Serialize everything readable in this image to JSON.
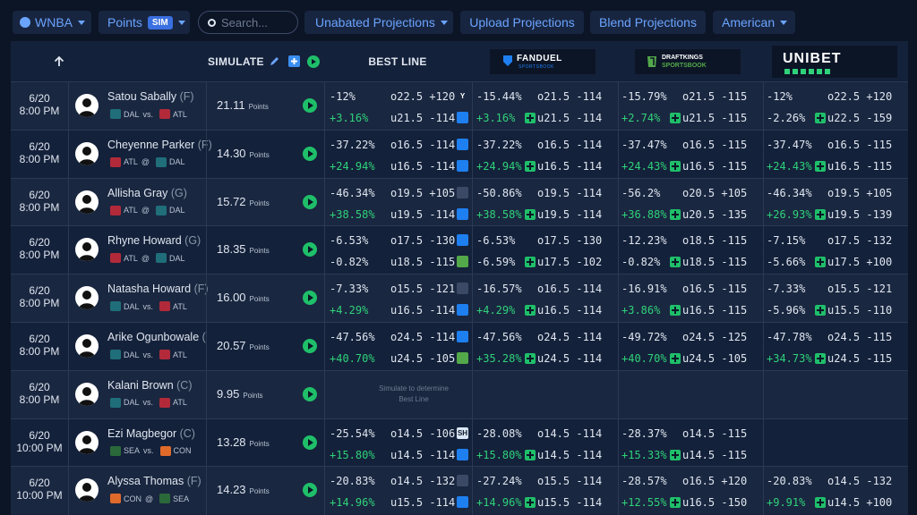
{
  "topbar": {
    "league": "WNBA",
    "stat": "Points",
    "sim_badge": "SIM",
    "search_placeholder": "Search...",
    "unabated": "Unabated Projections",
    "upload": "Upload Projections",
    "blend": "Blend Projections",
    "odds_format": "American"
  },
  "header": {
    "simulate": "SIMULATE",
    "best_line": "BEST LINE",
    "fanduel": "FANDUEL",
    "fanduel_sub": "SPORTSBOOK",
    "draftkings": "DRAFTKINGS",
    "draftkings_sub": "SPORTSBOOK",
    "unibet": "UNIBET"
  },
  "colors": {
    "accent": "#6aa4ff",
    "green": "#2fd27a",
    "bg": "#0c1526",
    "table": "#14213a"
  },
  "simulate_note": [
    "Simulate to determine",
    "Best Line"
  ],
  "rows": [
    {
      "date": "6/20",
      "time": "8:00 PM",
      "name": "Satou Sabally",
      "pos": "(F)",
      "t1": "DAL",
      "sep": "vs.",
      "t2": "ATL",
      "proj": "21.11",
      "unit": "Points",
      "best": {
        "oe": "-12%",
        "ol": "o22.5 +120",
        "ue": "+3.16%",
        "ul": "u21.5 -114",
        "oicon": "Y",
        "uicon": "fd"
      },
      "books": [
        {
          "oe": "-15.44%",
          "ol": "o21.5 -114",
          "ue": "+3.16%",
          "ul": "u21.5 -114"
        },
        {
          "oe": "-15.79%",
          "ol": "o21.5 -115",
          "ue": "+2.74%",
          "ul": "u21.5 -115"
        },
        {
          "oe": "-12%",
          "ol": "o22.5 +120",
          "ue": "-2.26%",
          "ul": "u22.5 -159"
        }
      ]
    },
    {
      "date": "6/20",
      "time": "8:00 PM",
      "name": "Cheyenne Parker",
      "pos": "(F)",
      "t1": "ATL",
      "sep": "@",
      "t2": "DAL",
      "proj": "14.30",
      "unit": "Points",
      "best": {
        "oe": "-37.22%",
        "ol": "o16.5 -114",
        "ue": "+24.94%",
        "ul": "u16.5 -114",
        "oicon": "fd",
        "uicon": "fd"
      },
      "books": [
        {
          "oe": "-37.22%",
          "ol": "o16.5 -114",
          "ue": "+24.94%",
          "ul": "u16.5 -114"
        },
        {
          "oe": "-37.47%",
          "ol": "o16.5 -115",
          "ue": "+24.43%",
          "ul": "u16.5 -115"
        },
        {
          "oe": "-37.47%",
          "ol": "o16.5 -115",
          "ue": "+24.43%",
          "ul": "u16.5 -115"
        }
      ]
    },
    {
      "date": "6/20",
      "time": "8:00 PM",
      "name": "Allisha Gray",
      "pos": "(G)",
      "t1": "ATL",
      "sep": "@",
      "t2": "DAL",
      "proj": "15.72",
      "unit": "Points",
      "best": {
        "oe": "-46.34%",
        "ol": "o19.5 +105",
        "ue": "+38.58%",
        "ul": "u19.5 -114",
        "oicon": "ub",
        "uicon": "fd"
      },
      "books": [
        {
          "oe": "-50.86%",
          "ol": "o19.5 -114",
          "ue": "+38.58%",
          "ul": "u19.5 -114"
        },
        {
          "oe": "-56.2%",
          "ol": "o20.5 +105",
          "ue": "+36.88%",
          "ul": "u20.5 -135"
        },
        {
          "oe": "-46.34%",
          "ol": "o19.5 +105",
          "ue": "+26.93%",
          "ul": "u19.5 -139"
        }
      ]
    },
    {
      "date": "6/20",
      "time": "8:00 PM",
      "name": "Rhyne Howard",
      "pos": "(G)",
      "t1": "ATL",
      "sep": "@",
      "t2": "DAL",
      "proj": "18.35",
      "unit": "Points",
      "best": {
        "oe": "-6.53%",
        "ol": "o17.5 -130",
        "ue": "-0.82%",
        "ul": "u18.5 -115",
        "oicon": "fd",
        "uicon": "dk"
      },
      "books": [
        {
          "oe": "-6.53%",
          "ol": "o17.5 -130",
          "ue": "-6.59%",
          "ul": "u17.5 -102"
        },
        {
          "oe": "-12.23%",
          "ol": "o18.5 -115",
          "ue": "-0.82%",
          "ul": "u18.5 -115"
        },
        {
          "oe": "-7.15%",
          "ol": "o17.5 -132",
          "ue": "-5.66%",
          "ul": "u17.5 +100"
        }
      ]
    },
    {
      "date": "6/20",
      "time": "8:00 PM",
      "name": "Natasha Howard",
      "pos": "(F)",
      "t1": "DAL",
      "sep": "vs.",
      "t2": "ATL",
      "proj": "16.00",
      "unit": "Points",
      "best": {
        "oe": "-7.33%",
        "ol": "o15.5 -121",
        "ue": "+4.29%",
        "ul": "u16.5 -114",
        "oicon": "ub",
        "uicon": "fd"
      },
      "books": [
        {
          "oe": "-16.57%",
          "ol": "o16.5 -114",
          "ue": "+4.29%",
          "ul": "u16.5 -114"
        },
        {
          "oe": "-16.91%",
          "ol": "o16.5 -115",
          "ue": "+3.86%",
          "ul": "u16.5 -115"
        },
        {
          "oe": "-7.33%",
          "ol": "o15.5 -121",
          "ue": "-5.96%",
          "ul": "u15.5 -110"
        }
      ]
    },
    {
      "date": "6/20",
      "time": "8:00 PM",
      "name": "Arike Ogunbowale",
      "pos": "(",
      "t1": "DAL",
      "sep": "vs.",
      "t2": "ATL",
      "proj": "20.57",
      "unit": "Points",
      "best": {
        "oe": "-47.56%",
        "ol": "o24.5 -114",
        "ue": "+40.70%",
        "ul": "u24.5 -105",
        "oicon": "fd",
        "uicon": "dk"
      },
      "books": [
        {
          "oe": "-47.56%",
          "ol": "o24.5 -114",
          "ue": "+35.28%",
          "ul": "u24.5 -114"
        },
        {
          "oe": "-49.72%",
          "ol": "o24.5 -125",
          "ue": "+40.70%",
          "ul": "u24.5 -105"
        },
        {
          "oe": "-47.78%",
          "ol": "o24.5 -115",
          "ue": "+34.73%",
          "ul": "u24.5 -115"
        }
      ]
    },
    {
      "date": "6/20",
      "time": "8:00 PM",
      "name": "Kalani Brown",
      "pos": "(C)",
      "t1": "DAL",
      "sep": "vs.",
      "t2": "ATL",
      "proj": "9.95",
      "unit": "Points",
      "best": null,
      "books": [
        null,
        null,
        null
      ]
    },
    {
      "date": "6/20",
      "time": "10:00 PM",
      "name": "Ezi Magbegor",
      "pos": "(C)",
      "t1": "SEA",
      "sep": "vs.",
      "t2": "CON",
      "proj": "13.28",
      "unit": "Points",
      "best": {
        "oe": "-25.54%",
        "ol": "o14.5 -106",
        "ue": "+15.80%",
        "ul": "u14.5 -114",
        "oicon": "SH",
        "uicon": "fd"
      },
      "books": [
        {
          "oe": "-28.08%",
          "ol": "o14.5 -114",
          "ue": "+15.80%",
          "ul": "u14.5 -114"
        },
        {
          "oe": "-28.37%",
          "ol": "o14.5 -115",
          "ue": "+15.33%",
          "ul": "u14.5 -115"
        },
        null
      ]
    },
    {
      "date": "6/20",
      "time": "10:00 PM",
      "name": "Alyssa Thomas",
      "pos": "(F)",
      "t1": "CON",
      "sep": "@",
      "t2": "SEA",
      "proj": "14.23",
      "unit": "Points",
      "best": {
        "oe": "-20.83%",
        "ol": "o14.5 -132",
        "ue": "+14.96%",
        "ul": "u15.5 -114",
        "oicon": "ub",
        "uicon": "fd"
      },
      "books": [
        {
          "oe": "-27.24%",
          "ol": "o15.5 -114",
          "ue": "+14.96%",
          "ul": "u15.5 -114"
        },
        {
          "oe": "-28.57%",
          "ol": "o16.5 +120",
          "ue": "+12.55%",
          "ul": "u16.5 -150"
        },
        {
          "oe": "-20.83%",
          "ol": "o14.5 -132",
          "ue": "+9.91%",
          "ul": "u14.5 +100"
        }
      ]
    }
  ]
}
